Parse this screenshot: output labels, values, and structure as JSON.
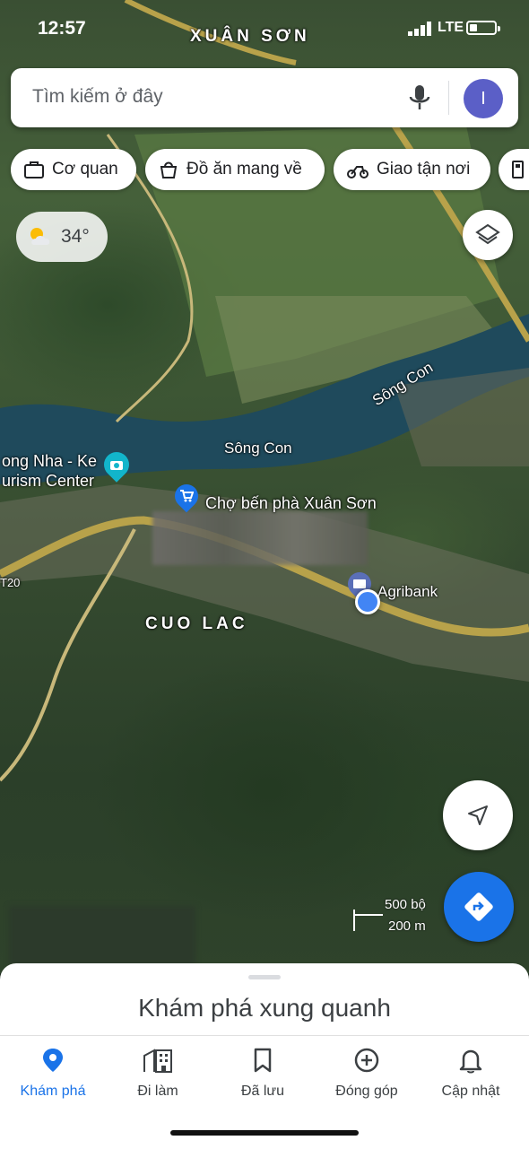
{
  "status_bar": {
    "time": "12:57",
    "network": "LTE"
  },
  "map": {
    "labels": {
      "area_top": "XUÂN SƠN",
      "river_1": "Sông Con",
      "river_2": "Sông Con",
      "tourism_line1": "ong Nha - Ke",
      "tourism_line2": "urism Center",
      "market": "Chợ bến phà Xuân Sơn",
      "bank": "Agribank",
      "area_bottom": "CUO LAC",
      "road": "T20"
    },
    "scale": {
      "top": "500 bộ",
      "bottom": "200 m"
    }
  },
  "search": {
    "placeholder": "Tìm kiếm ở đây",
    "avatar_letter": "I"
  },
  "chips": [
    {
      "label": "Cơ quan",
      "icon": "briefcase-icon"
    },
    {
      "label": "Đồ ăn mang về",
      "icon": "takeout-icon"
    },
    {
      "label": "Giao tận nơi",
      "icon": "delivery-icon"
    }
  ],
  "weather": {
    "temp": "34°",
    "icon": "partly-cloudy-icon"
  },
  "sheet": {
    "title": "Khám phá xung quanh"
  },
  "nav": [
    {
      "label": "Khám phá",
      "icon": "explore-pin-icon",
      "active": true
    },
    {
      "label": "Đi làm",
      "icon": "commute-icon",
      "active": false
    },
    {
      "label": "Đã lưu",
      "icon": "bookmark-icon",
      "active": false
    },
    {
      "label": "Đóng góp",
      "icon": "add-circle-icon",
      "active": false
    },
    {
      "label": "Cập nhật",
      "icon": "bell-icon",
      "active": false
    }
  ],
  "colors": {
    "accent": "#1a73e8",
    "avatar": "#5b5fc7",
    "river": "#1f4a5c",
    "road": "#b8a24a"
  }
}
